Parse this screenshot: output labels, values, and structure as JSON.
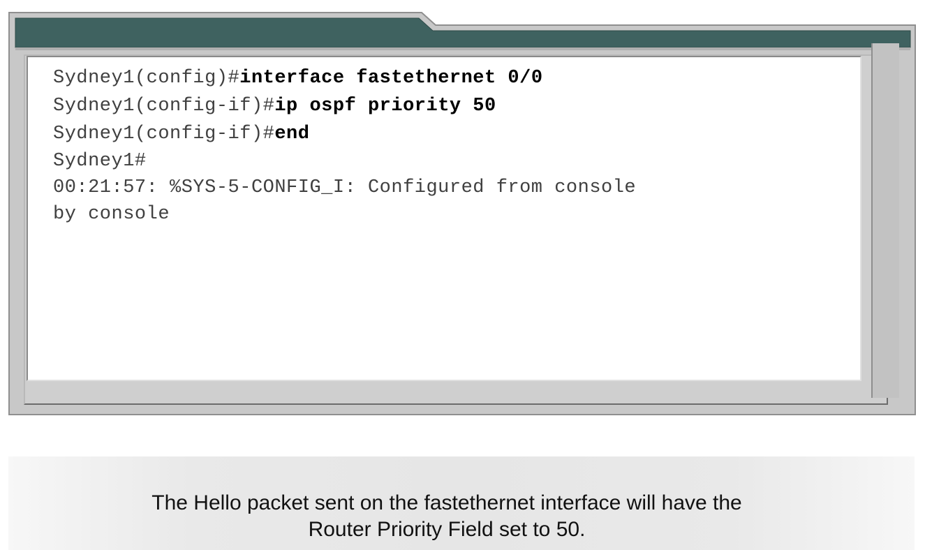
{
  "console": {
    "lines": [
      {
        "prompt": "Sydney1(config)#",
        "command": "interface fastethernet 0/0"
      },
      {
        "prompt": "Sydney1(config-if)#",
        "command": "ip ospf priority 50"
      },
      {
        "prompt": "Sydney1(config-if)#",
        "command": "end"
      },
      {
        "prompt": "Sydney1#",
        "command": ""
      },
      {
        "text": "00:21:57: %SYS-5-CONFIG_I: Configured from console"
      },
      {
        "text": "by console"
      }
    ]
  },
  "caption": {
    "line1": "The Hello packet sent on the fastethernet interface will have the",
    "line2": "Router Priority Field set to 50."
  },
  "colors": {
    "title_bar": "#3f6260",
    "frame_gray": "#c8c8c8",
    "console_bg": "#ffffff"
  }
}
